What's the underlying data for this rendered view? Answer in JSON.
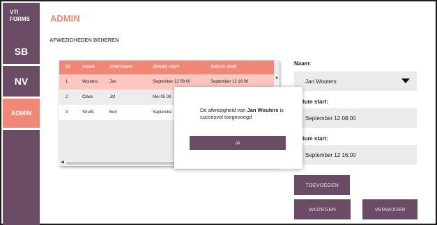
{
  "app": {
    "logo_line1": "VTI",
    "logo_line2": "FORMS",
    "page_title": "ADMIN",
    "section_title": "AFWEZIGHEDEN BEHEREN"
  },
  "sidebar": {
    "items": [
      {
        "label": "SB"
      },
      {
        "label": "NV"
      },
      {
        "label": "ADMIN",
        "active": true
      }
    ]
  },
  "table": {
    "headers": [
      "ID",
      "naam",
      "voornaam",
      "datum start",
      "datum eind"
    ],
    "rows": [
      {
        "id": "1",
        "naam": "Wouters",
        "voornaam": "Jan",
        "start": "September 12 08:00",
        "eind": "September 12 16:00"
      },
      {
        "id": "2",
        "naam": "Claes",
        "voornaam": "Jef",
        "start": "Mei 05 09",
        "eind": ""
      },
      {
        "id": "3",
        "naam": "Struifs",
        "voornaam": "Bert",
        "start": "Septembe",
        "eind": ""
      }
    ]
  },
  "modal": {
    "msg_prefix": "De afwezigheid van ",
    "msg_name": "Jan Wouters",
    "msg_suffix": " is succesvol toegevoegd",
    "ok_label": "ok"
  },
  "form": {
    "naam_label": "Naam:",
    "naam_value": "Jan Wouters",
    "start_label": "tum start:",
    "start_value": "September 12 08:00",
    "eind_label": "tum start:",
    "eind_value": "September 12 16:00"
  },
  "buttons": {
    "toevoegen": "TOEVOEGEN",
    "wijzigen": "WIJZEGEN",
    "verwijder": "VERWIJDER"
  },
  "colors": {
    "sidebar": "#6a4d65",
    "accent": "#f08878",
    "selected_row": "#fbc7c0"
  }
}
